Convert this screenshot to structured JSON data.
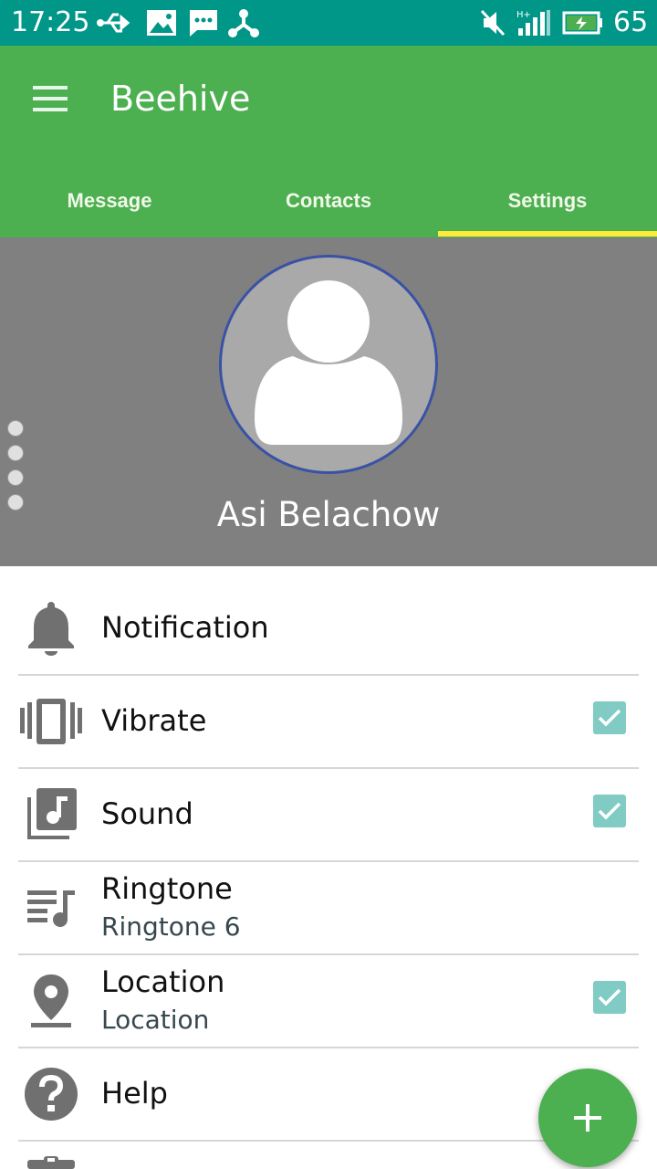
{
  "status_bar": {
    "time": "17:25",
    "battery_percent": "65",
    "icons": [
      "usb-icon",
      "image-icon",
      "message-icon",
      "share-icon",
      "mute-icon",
      "signal-icon",
      "battery-charging-icon"
    ]
  },
  "app_bar": {
    "title": "Beehive",
    "tabs": [
      {
        "label": "Message",
        "selected": false
      },
      {
        "label": "Contacts",
        "selected": false
      },
      {
        "label": "Settings",
        "selected": true
      }
    ],
    "colors": {
      "primary": "#4caf50",
      "status": "#009688",
      "indicator": "#ffeb3b"
    }
  },
  "profile": {
    "name": "Asi Belachow"
  },
  "settings": [
    {
      "label": "Notification",
      "icon": "bell-icon"
    },
    {
      "label": "Vibrate",
      "icon": "vibrate-icon",
      "checked": true
    },
    {
      "label": "Sound",
      "icon": "music-library-icon",
      "checked": true
    },
    {
      "label": "Ringtone",
      "value": "Ringtone 6",
      "icon": "playlist-music-icon"
    },
    {
      "label": "Location",
      "value": "Location",
      "icon": "location-pin-icon",
      "checked": true
    },
    {
      "label": "Help",
      "icon": "help-icon"
    }
  ],
  "fab": {
    "icon": "plus-icon",
    "color": "#4caf50"
  }
}
